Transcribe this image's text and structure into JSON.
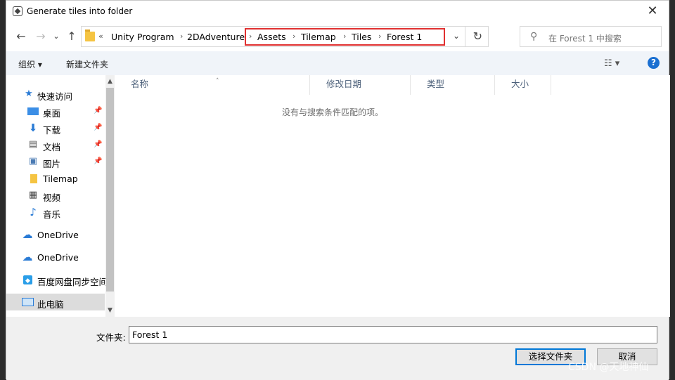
{
  "window": {
    "title": "Generate tiles into folder"
  },
  "nav": {
    "back": "←",
    "forward": "→",
    "recent": "⌄",
    "up": "↑"
  },
  "address": {
    "overflow": "«",
    "crumbs": [
      "Unity Program",
      "2DAdventure",
      "Assets",
      "Tilemap",
      "Tiles",
      "Forest 1"
    ],
    "highlight_color": "#e03030"
  },
  "search": {
    "placeholder": "在 Forest 1 中搜索"
  },
  "toolbar": {
    "organize": "组织 ▾",
    "new_folder": "新建文件夹"
  },
  "sidebar": {
    "items": [
      {
        "label": "快速访问",
        "icon": "star-icon"
      },
      {
        "label": "桌面",
        "icon": "desktop-icon",
        "pinned": true
      },
      {
        "label": "下载",
        "icon": "download-icon",
        "pinned": true
      },
      {
        "label": "文档",
        "icon": "document-icon",
        "pinned": true
      },
      {
        "label": "图片",
        "icon": "pictures-icon",
        "pinned": true
      },
      {
        "label": "Tilemap",
        "icon": "folder-icon"
      },
      {
        "label": "视频",
        "icon": "video-icon"
      },
      {
        "label": "音乐",
        "icon": "music-icon"
      },
      {
        "label": "OneDrive",
        "icon": "cloud-icon"
      },
      {
        "label": "OneDrive",
        "icon": "cloud-icon"
      },
      {
        "label": "百度网盘同步空间",
        "icon": "baidu-netdisk-icon"
      },
      {
        "label": "此电脑",
        "icon": "computer-icon",
        "selected": true
      }
    ]
  },
  "columns": [
    "名称",
    "修改日期",
    "类型",
    "大小"
  ],
  "empty_message": "没有与搜索条件匹配的项。",
  "footer": {
    "folder_label": "文件夹:",
    "folder_value": "Forest 1",
    "select_button": "选择文件夹",
    "cancel_button": "取消"
  },
  "watermark": "CSDN @天地神仙",
  "colors": {
    "accent": "#0078d7",
    "help": "#1a6fd1",
    "folder": "#f5c442"
  }
}
